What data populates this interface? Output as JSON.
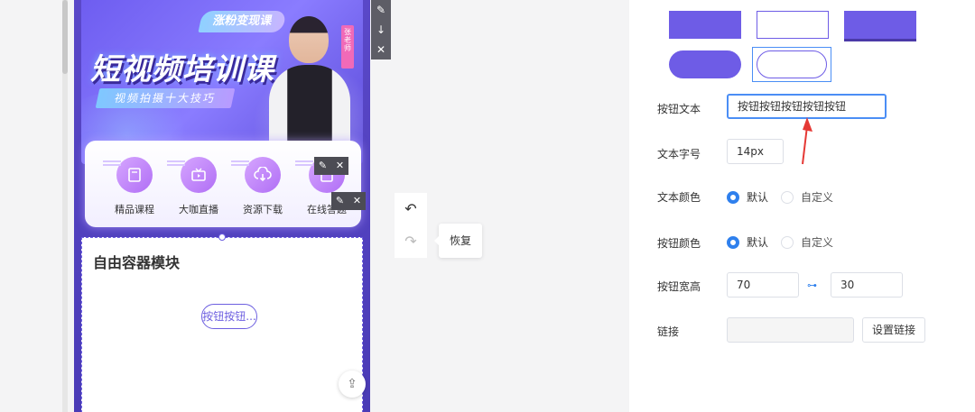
{
  "preview": {
    "banner": {
      "tag": "涨粉变现课",
      "title": "短视频培训课",
      "subtitle": "视频拍摄十大技巧",
      "badge": "张老师"
    },
    "nav_items": [
      {
        "label": "精品课程",
        "icon": "book-icon"
      },
      {
        "label": "大咖直播",
        "icon": "tv-icon"
      },
      {
        "label": "资源下载",
        "icon": "cloud-download-icon"
      },
      {
        "label": "在线答题",
        "icon": "edit-icon"
      }
    ],
    "container": {
      "title": "自由容器模块",
      "button_text": "按钮按钮..."
    }
  },
  "history": {
    "restore_tip": "恢复"
  },
  "panel": {
    "button_text_label": "按钮文本",
    "button_text_value": "按钮按钮按钮按钮按钮",
    "font_size_label": "文本字号",
    "font_size_value": "14px",
    "text_color_label": "文本颜色",
    "text_color_options": [
      "默认",
      "自定义"
    ],
    "button_color_label": "按钮颜色",
    "button_color_options": [
      "默认",
      "自定义"
    ],
    "size_label": "按钮宽高",
    "width_value": "70",
    "height_value": "30",
    "link_label": "链接",
    "link_value": "",
    "set_link_button": "设置链接"
  },
  "colors": {
    "accent": "#6e5ce6",
    "focus": "#4b8ef5",
    "radio": "#2f80ed",
    "annotation_arrow": "#e53935"
  }
}
